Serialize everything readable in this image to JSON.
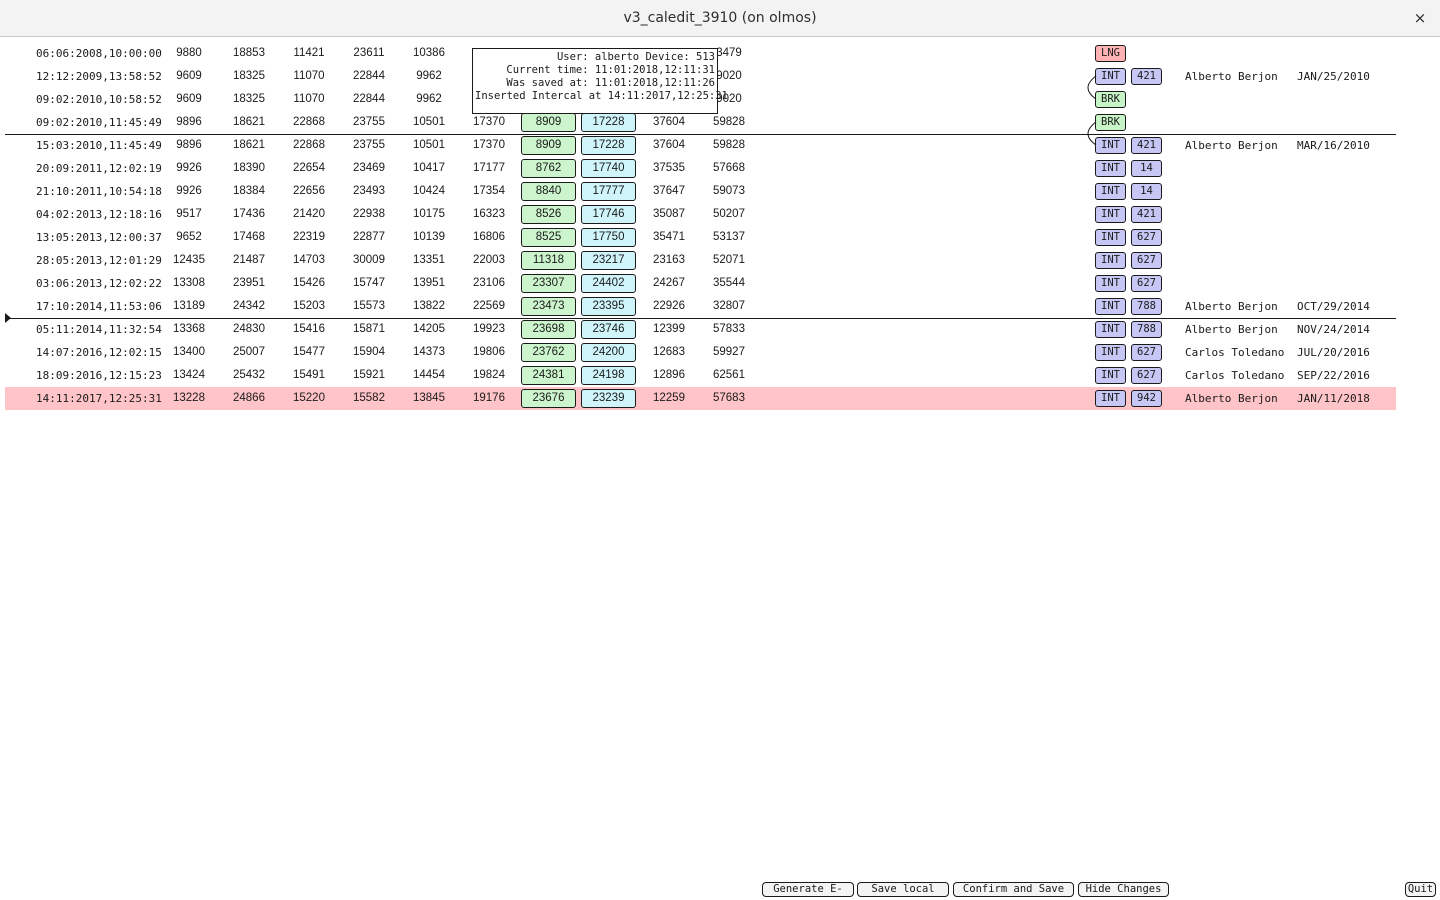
{
  "window": {
    "title": "v3_caledit_3910 (on olmos)",
    "close_label": "×"
  },
  "tooltip": {
    "lines": [
      "User: alberto Device: 513",
      "Current time: 11:01:2018,12:11:31",
      "Was saved at: 11:01:2018,12:11:26",
      "Inserted Intercal at 14:11:2017,12:25:31"
    ]
  },
  "rows": [
    {
      "date": "06:06:2008,10:00:00",
      "v1": "9880",
      "v2": "18853",
      "v3": "11421",
      "v4": "23611",
      "v5": "10386",
      "v6": "",
      "b1": "",
      "b2": "",
      "v7": "",
      "v8": "3479",
      "type": "LNG",
      "code": "",
      "user": "",
      "saved": ""
    },
    {
      "date": "12:12:2009,13:58:52",
      "v1": "9609",
      "v2": "18325",
      "v3": "11070",
      "v4": "22844",
      "v5": "9962",
      "v6": "",
      "b1": "",
      "b2": "",
      "v7": "",
      "v8": "9020",
      "type": "INT",
      "code": "421",
      "user": "Alberto Berjon",
      "saved": "JAN/25/2010"
    },
    {
      "date": "09:02:2010,10:58:52",
      "v1": "9609",
      "v2": "18325",
      "v3": "11070",
      "v4": "22844",
      "v5": "9962",
      "v6": "",
      "b1": "",
      "b2": "",
      "v7": "",
      "v8": "9020",
      "type": "BRK",
      "code": "",
      "user": "",
      "saved": ""
    },
    {
      "date": "09:02:2010,11:45:49",
      "v1": "9896",
      "v2": "18621",
      "v3": "22868",
      "v4": "23755",
      "v5": "10501",
      "v6": "17370",
      "b1": "8909",
      "b2": "17228",
      "v7": "37604",
      "v8": "59828",
      "type": "BRK",
      "code": "",
      "user": "",
      "saved": ""
    },
    {
      "date": "15:03:2010,11:45:49",
      "v1": "9896",
      "v2": "18621",
      "v3": "22868",
      "v4": "23755",
      "v5": "10501",
      "v6": "17370",
      "b1": "8909",
      "b2": "17228",
      "v7": "37604",
      "v8": "59828",
      "type": "INT",
      "code": "421",
      "user": "Alberto Berjon",
      "saved": "MAR/16/2010"
    },
    {
      "date": "20:09:2011,12:02:19",
      "v1": "9926",
      "v2": "18390",
      "v3": "22654",
      "v4": "23469",
      "v5": "10417",
      "v6": "17177",
      "b1": "8762",
      "b2": "17740",
      "v7": "37535",
      "v8": "57668",
      "type": "INT",
      "code": "14",
      "user": "",
      "saved": ""
    },
    {
      "date": "21:10:2011,10:54:18",
      "v1": "9926",
      "v2": "18384",
      "v3": "22656",
      "v4": "23493",
      "v5": "10424",
      "v6": "17354",
      "b1": "8840",
      "b2": "17777",
      "v7": "37647",
      "v8": "59073",
      "type": "INT",
      "code": "14",
      "user": "",
      "saved": ""
    },
    {
      "date": "04:02:2013,12:18:16",
      "v1": "9517",
      "v2": "17436",
      "v3": "21420",
      "v4": "22938",
      "v5": "10175",
      "v6": "16323",
      "b1": "8526",
      "b2": "17746",
      "v7": "35087",
      "v8": "50207",
      "type": "INT",
      "code": "421",
      "user": "",
      "saved": ""
    },
    {
      "date": "13:05:2013,12:00:37",
      "v1": "9652",
      "v2": "17468",
      "v3": "22319",
      "v4": "22877",
      "v5": "10139",
      "v6": "16806",
      "b1": "8525",
      "b2": "17750",
      "v7": "35471",
      "v8": "53137",
      "type": "INT",
      "code": "627",
      "user": "",
      "saved": ""
    },
    {
      "date": "28:05:2013,12:01:29",
      "v1": "12435",
      "v2": "21487",
      "v3": "14703",
      "v4": "30009",
      "v5": "13351",
      "v6": "22003",
      "b1": "11318",
      "b2": "23217",
      "v7": "23163",
      "v8": "52071",
      "type": "INT",
      "code": "627",
      "user": "",
      "saved": ""
    },
    {
      "date": "03:06:2013,12:02:22",
      "v1": "13308",
      "v2": "23951",
      "v3": "15426",
      "v4": "15747",
      "v5": "13951",
      "v6": "23106",
      "b1": "23307",
      "b2": "24402",
      "v7": "24267",
      "v8": "35544",
      "type": "INT",
      "code": "627",
      "user": "",
      "saved": ""
    },
    {
      "date": "17:10:2014,11:53:06",
      "v1": "13189",
      "v2": "24342",
      "v3": "15203",
      "v4": "15573",
      "v5": "13822",
      "v6": "22569",
      "b1": "23473",
      "b2": "23395",
      "v7": "22926",
      "v8": "32807",
      "type": "INT",
      "code": "788",
      "user": "Alberto Berjon",
      "saved": "OCT/29/2014"
    },
    {
      "date": "05:11:2014,11:32:54",
      "v1": "13368",
      "v2": "24830",
      "v3": "15416",
      "v4": "15871",
      "v5": "14205",
      "v6": "19923",
      "b1": "23698",
      "b2": "23746",
      "v7": "12399",
      "v8": "57833",
      "type": "INT",
      "code": "788",
      "user": "Alberto Berjon",
      "saved": "NOV/24/2014"
    },
    {
      "date": "14:07:2016,12:02:15",
      "v1": "13400",
      "v2": "25007",
      "v3": "15477",
      "v4": "15904",
      "v5": "14373",
      "v6": "19806",
      "b1": "23762",
      "b2": "24200",
      "v7": "12683",
      "v8": "59927",
      "type": "INT",
      "code": "627",
      "user": "Carlos Toledano",
      "saved": "JUL/20/2016"
    },
    {
      "date": "18:09:2016,12:15:23",
      "v1": "13424",
      "v2": "25432",
      "v3": "15491",
      "v4": "15921",
      "v5": "14454",
      "v6": "19824",
      "b1": "24381",
      "b2": "24198",
      "v7": "12896",
      "v8": "62561",
      "type": "INT",
      "code": "627",
      "user": "Carlos Toledano",
      "saved": "SEP/22/2016"
    },
    {
      "date": "14:11:2017,12:25:31",
      "v1": "13228",
      "v2": "24866",
      "v3": "15220",
      "v4": "15582",
      "v5": "13845",
      "v6": "19176",
      "b1": "23676",
      "b2": "23239",
      "v7": "12259",
      "v8": "57683",
      "type": "INT",
      "code": "942",
      "user": "Alberto Berjon",
      "saved": "JAN/11/2018",
      "highlighted": true
    }
  ],
  "footer": {
    "generate_email": "Generate E-mail",
    "save_local": "Save local file",
    "confirm_save": "Confirm and Save",
    "hide_changes": "Hide Changes",
    "quit": "Quit"
  }
}
